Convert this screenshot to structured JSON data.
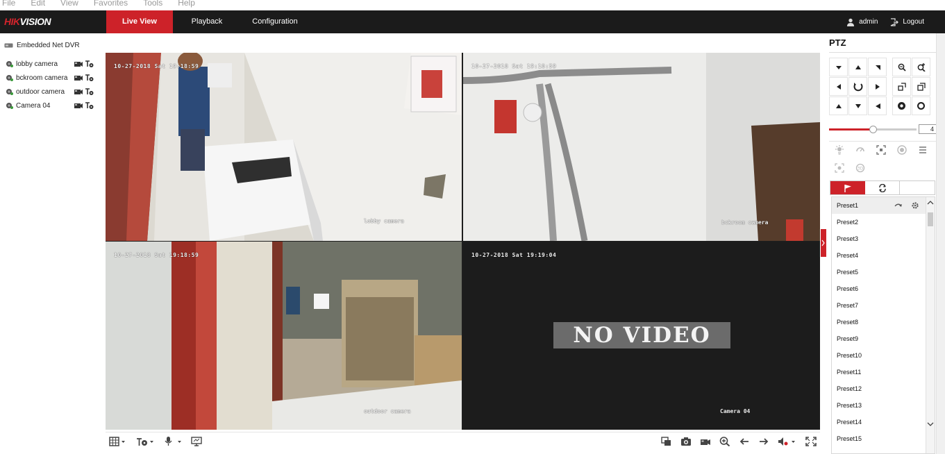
{
  "browser_menu": [
    "File",
    "Edit",
    "View",
    "Favorites",
    "Tools",
    "Help"
  ],
  "header": {
    "logo_part1": "HIK",
    "logo_part2": "VISION",
    "tabs": [
      "Live View",
      "Playback",
      "Configuration"
    ],
    "active_tab": "Live View",
    "user": "admin",
    "logout": "Logout"
  },
  "sidebar": {
    "device": "Embedded Net DVR",
    "cameras": [
      {
        "label": "lobby camera"
      },
      {
        "label": "bckroom camera"
      },
      {
        "label": "outdoor camera"
      },
      {
        "label": "Camera 04"
      }
    ]
  },
  "video_tiles": [
    {
      "timestamp": "10-27-2018 Sat 19:18:59",
      "name": "lobby camera",
      "selected": true
    },
    {
      "timestamp": "10-27-2018 Sat 19:18:59",
      "name": "bckroom camera",
      "selected": false
    },
    {
      "timestamp": "10-27-2018 Sat 19:18:59",
      "name": "outdoor camera",
      "selected": false
    },
    {
      "timestamp": "10-27-2018 Sat 19:19:04",
      "name": "Camera 04",
      "no_video": "NO VIDEO",
      "selected": false
    }
  ],
  "ptz": {
    "title": "PTZ",
    "speed": "4",
    "speed_level": 0.5,
    "presets": [
      "Preset1",
      "Preset2",
      "Preset3",
      "Preset4",
      "Preset5",
      "Preset6",
      "Preset7",
      "Preset8",
      "Preset9",
      "Preset10",
      "Preset11",
      "Preset12",
      "Preset13",
      "Preset14",
      "Preset15"
    ],
    "selected_preset": "Preset1"
  },
  "colors": {
    "brand_red": "#cd2229",
    "header_bg": "#1b1b1b",
    "selected_outline": "#e3a800"
  }
}
